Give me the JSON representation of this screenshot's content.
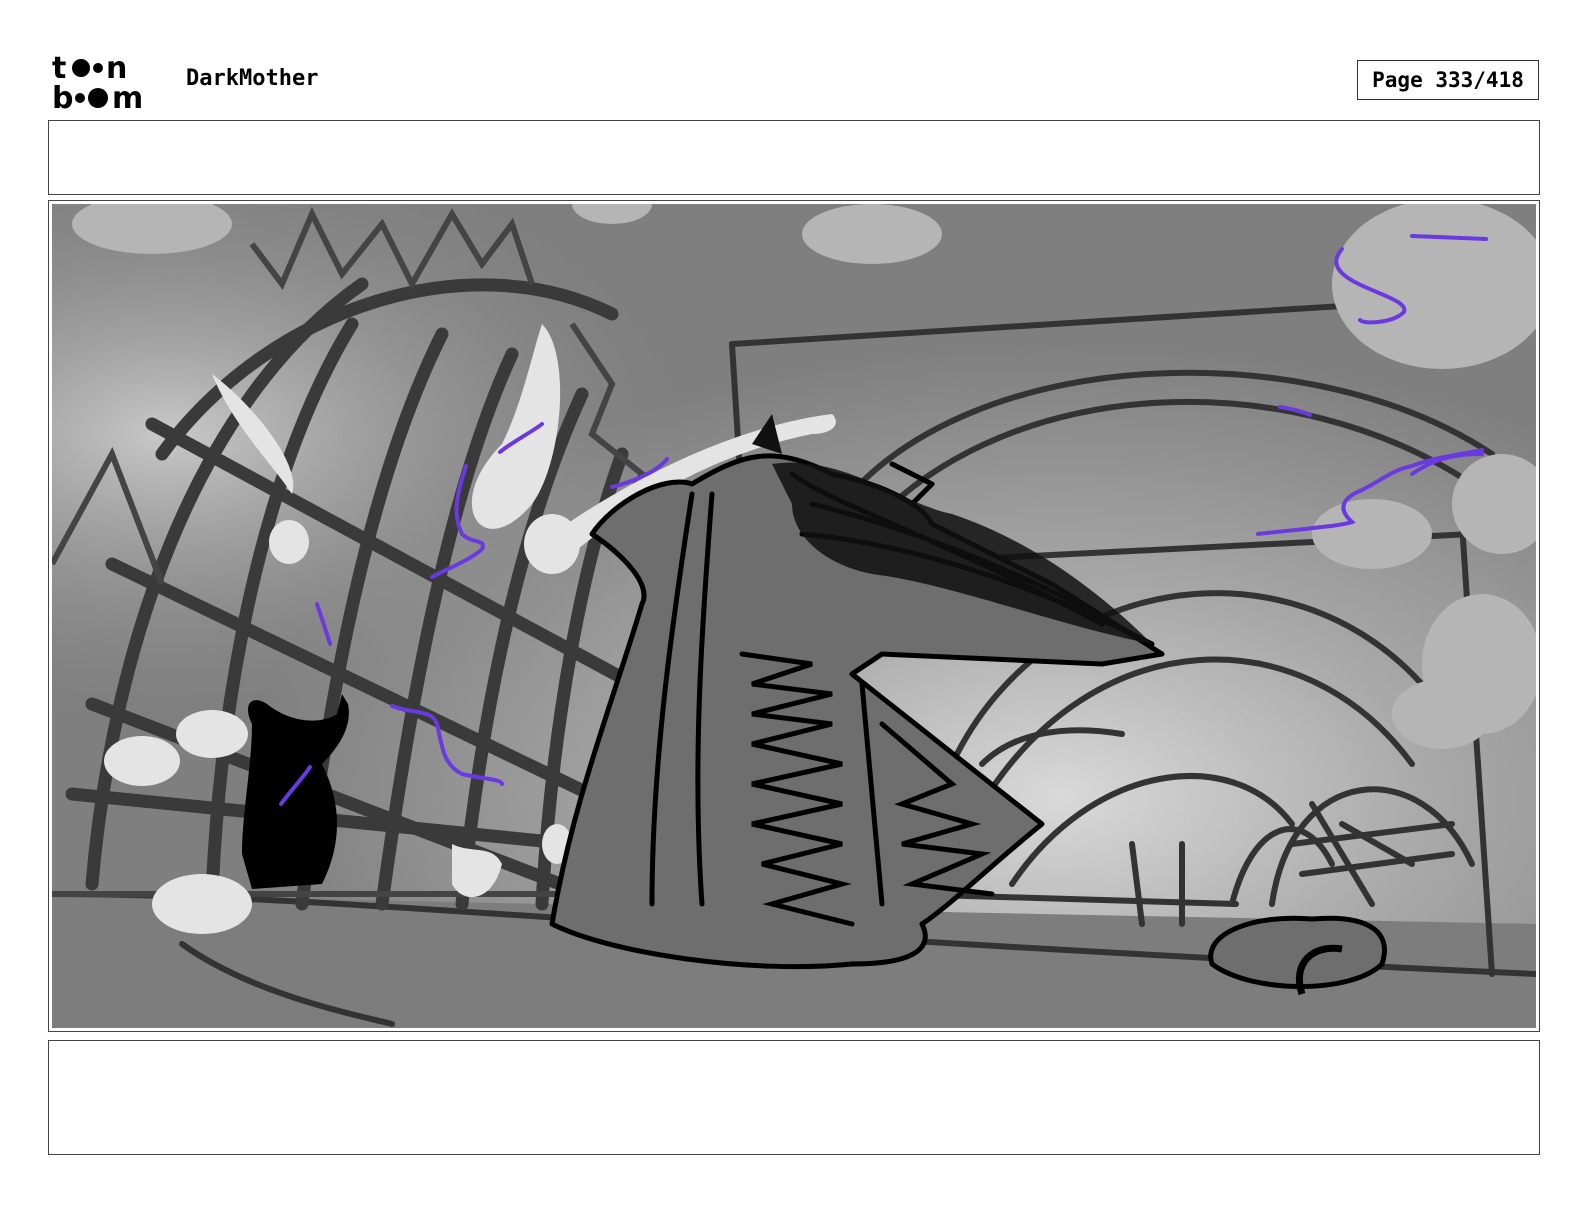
{
  "header": {
    "logo_text": "toon boom",
    "project_title": "DarkMother",
    "page_label": "Page 333/418"
  },
  "panel": {
    "image_description_icon": "storyboard-sketch"
  },
  "colors": {
    "accent_violet": "#6a3ae0",
    "sketch_black": "#000000",
    "background_gray": "#8a8a8a"
  }
}
